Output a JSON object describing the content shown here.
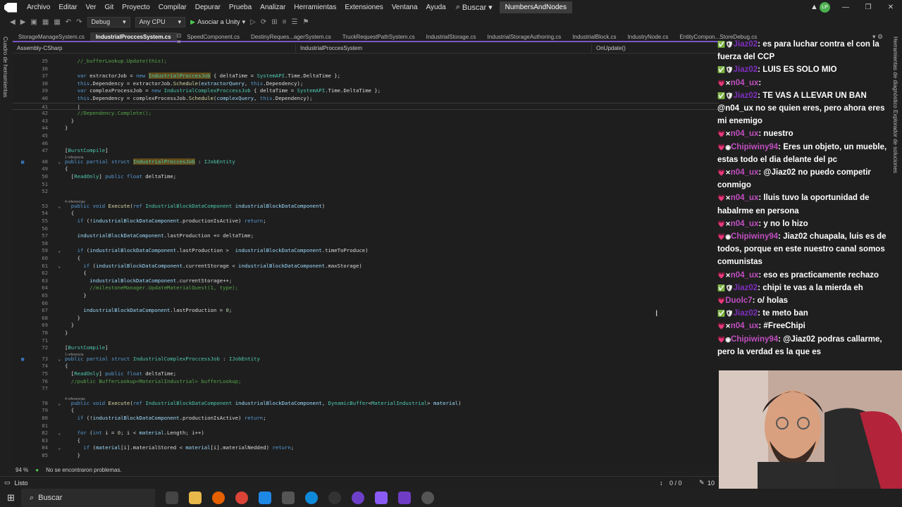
{
  "menubar": {
    "items": [
      "Archivo",
      "Editar",
      "Ver",
      "Git",
      "Proyecto",
      "Compilar",
      "Depurar",
      "Prueba",
      "Analizar",
      "Herramientas",
      "Extensiones",
      "Ventana",
      "Ayuda"
    ],
    "search": "Buscar",
    "solution": "NumbersAndNodes",
    "avatar": "LP"
  },
  "toolbar": {
    "config": "Debug",
    "platform": "Any CPU",
    "attach": "Asociar a Unity"
  },
  "tabs": [
    "StorageManageSystem.cs",
    "IndustrialProccesSystem.cs",
    "SpeedComponent.cs",
    "DestinyReques...agerSystem.cs",
    "TruckRequestPathSystem.cs",
    "IndustrialStorage.cs",
    "IndustrialStorageAuthoring.cs",
    "IndustrialBlock.cs",
    "IndustryNode.cs",
    "EntityCompon...StoreDebug.cs"
  ],
  "navbar": {
    "assembly": "Assembly-CSharp",
    "type": "IndustrialProccesSystem",
    "member": "OnUpdate()"
  },
  "left_strip": "Cuadro de herramientas",
  "right_strip": "Herramientas de diagnóstico  Explorador de soluciones",
  "editor_status": {
    "zoom": "94 %",
    "problems": "No se encontraron problemas."
  },
  "statusbar": {
    "state": "Listo",
    "git": "0 / 0",
    "edits": "10"
  },
  "taskbar": {
    "search": "Buscar"
  },
  "code_refs": {
    "one": "1 referencia",
    "four": "4 referencias"
  },
  "lines": [
    {
      "n": "35",
      "t": "    //_bufferLookup.Update(this);"
    },
    {
      "n": "36",
      "t": ""
    },
    {
      "n": "37",
      "t": "    var extractorJob = new IndustrialProccesJob { deltaTime = SystemAPI.Time.DeltaTime };"
    },
    {
      "n": "38",
      "t": "    this.Dependency = extractorJob.Schedule(extractorQuery, this.Dependency);"
    },
    {
      "n": "39",
      "t": "    var complexProcessJob = new IndustrialComplexProccessJob { deltaTime = SystemAPI.Time.DeltaTime };"
    },
    {
      "n": "40",
      "t": "    this.Dependency = complexProcessJob.Schedule(complexQuery, this.Dependency);"
    },
    {
      "n": "41",
      "t": "    |"
    },
    {
      "n": "42",
      "t": "    //Dependency.Complete();"
    },
    {
      "n": "43",
      "t": "  }"
    },
    {
      "n": "44",
      "t": "}"
    },
    {
      "n": "45",
      "t": ""
    },
    {
      "n": "46",
      "t": ""
    },
    {
      "n": "47",
      "t": "[BurstCompile]"
    },
    {
      "n": "48",
      "t": "public partial struct IndustrialProccesJob : IJobEntity"
    },
    {
      "n": "49",
      "t": "{"
    },
    {
      "n": "50",
      "t": "  [ReadOnly] public float deltaTime;"
    },
    {
      "n": "51",
      "t": ""
    },
    {
      "n": "52",
      "t": ""
    },
    {
      "n": "53",
      "t": "  public void Execute(ref IndustrialBlockDataComponent industrialBlockDataComponent)"
    },
    {
      "n": "54",
      "t": "  {"
    },
    {
      "n": "55",
      "t": "    if (!industrialBlockDataComponent.productionIsActive) return;"
    },
    {
      "n": "56",
      "t": ""
    },
    {
      "n": "57",
      "t": "    industrialBlockDataComponent.lastProduction += deltaTime;"
    },
    {
      "n": "58",
      "t": ""
    },
    {
      "n": "59",
      "t": "    if (industrialBlockDataComponent.lastProduction >  industrialBlockDataComponent.timeToProduce)"
    },
    {
      "n": "60",
      "t": "    {"
    },
    {
      "n": "61",
      "t": "      if (industrialBlockDataComponent.currentStorage < industrialBlockDataComponent.maxStorage)"
    },
    {
      "n": "62",
      "t": "      {"
    },
    {
      "n": "63",
      "t": "        industrialBlockDataComponent.currentStorage++;"
    },
    {
      "n": "64",
      "t": "        //milestoneManager.UpdateMaterialQuest(1, type);"
    },
    {
      "n": "65",
      "t": "      }"
    },
    {
      "n": "66",
      "t": ""
    },
    {
      "n": "67",
      "t": "      industrialBlockDataComponent.lastProduction = 0;"
    },
    {
      "n": "68",
      "t": "    }"
    },
    {
      "n": "69",
      "t": "  }"
    },
    {
      "n": "70",
      "t": "}"
    },
    {
      "n": "71",
      "t": ""
    },
    {
      "n": "72",
      "t": "[BurstCompile]"
    },
    {
      "n": "73",
      "t": "public partial struct IndustrialComplexProccessJob : IJobEntity"
    },
    {
      "n": "74",
      "t": "{"
    },
    {
      "n": "75",
      "t": "  [ReadOnly] public float deltaTime;"
    },
    {
      "n": "76",
      "t": "  //public BufferLookup<MaterialIndustrial> bufferLookup;"
    },
    {
      "n": "77",
      "t": ""
    },
    {
      "n": "78",
      "t": "  public void Execute(ref IndustrialBlockDataComponent industrialBlockDataComponent, DynamicBuffer<MaterialIndustrial> material)"
    },
    {
      "n": "79",
      "t": "  {"
    },
    {
      "n": "80",
      "t": "    if (!industrialBlockDataComponent.productionIsActive) return;"
    },
    {
      "n": "81",
      "t": ""
    },
    {
      "n": "82",
      "t": "    for (int i = 0; i < material.Length; i++)"
    },
    {
      "n": "83",
      "t": "    {"
    },
    {
      "n": "84",
      "t": "      if (material[i].materialStored < material[i].materialNedded) return;"
    },
    {
      "n": "85",
      "t": "    }"
    }
  ],
  "chat": [
    {
      "user": "Jiaz02",
      "uclass": "u-green",
      "badge": "mod",
      "text": "es para luchar contra el con la fuerza del CCP"
    },
    {
      "user": "Jiaz02",
      "uclass": "u-green",
      "badge": "mod",
      "text": "LUIS ES SOLO MIO"
    },
    {
      "user": "n04_ux",
      "uclass": "u-pink",
      "badge": "x",
      "text": ""
    },
    {
      "user": "Jiaz02",
      "uclass": "u-green",
      "badge": "mod",
      "text": "TE VAS A LLEVAR UN BAN @n04_ux no se quien eres, pero ahora eres mi enemigo"
    },
    {
      "user": "n04_ux",
      "uclass": "u-pink",
      "badge": "x",
      "text": "nuestro"
    },
    {
      "user": "Chipiwiny94",
      "uclass": "u-pink",
      "badge": "sub",
      "text": "Eres un objeto, un mueble, estas todo el dia delante del pc"
    },
    {
      "user": "n04_ux",
      "uclass": "u-pink",
      "badge": "x",
      "text": "@Jiaz02 no puedo competir conmigo"
    },
    {
      "user": "n04_ux",
      "uclass": "u-pink",
      "badge": "x",
      "text": "lluis tuvo la oportunidad de habalrme en persona"
    },
    {
      "user": "n04_ux",
      "uclass": "u-pink",
      "badge": "x",
      "text": "y no lo hizo"
    },
    {
      "user": "Chipiwiny94",
      "uclass": "u-pink",
      "badge": "sub",
      "text": "Jiaz02 chuapala, luis es de todos, porque en este nuestro canal somos comunistas"
    },
    {
      "user": "n04_ux",
      "uclass": "u-pink",
      "badge": "x",
      "text": "eso es practicamente rechazo"
    },
    {
      "user": "Jiaz02",
      "uclass": "u-green",
      "badge": "mod",
      "text": "chipi te vas a la mierda eh"
    },
    {
      "user": "Duolc7",
      "uclass": "u-pink",
      "badge": "",
      "text": "o/ holas"
    },
    {
      "user": "Jiaz02",
      "uclass": "u-green",
      "badge": "mod",
      "text": "te meto ban"
    },
    {
      "user": "n04_ux",
      "uclass": "u-pink",
      "badge": "x",
      "text": "#FreeChipi"
    },
    {
      "user": "Chipiwiny94",
      "uclass": "u-pink",
      "badge": "sub",
      "text": "@Jiaz02 podras callarme, pero la verdad es la que es"
    }
  ]
}
